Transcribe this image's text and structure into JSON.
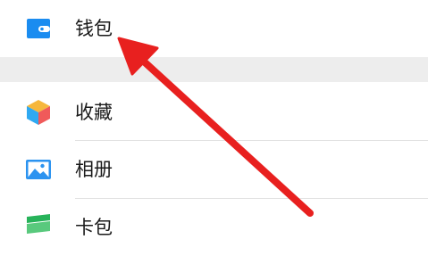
{
  "menu": {
    "items": [
      {
        "label": "钱包",
        "icon": "wallet-icon"
      },
      {
        "label": "收藏",
        "icon": "favorites-cube-icon"
      },
      {
        "label": "相册",
        "icon": "album-picture-icon"
      },
      {
        "label": "卡包",
        "icon": "card-bag-icon"
      }
    ]
  },
  "annotation": {
    "arrow": "red-arrow-pointing-to-wallet",
    "color": "#e8201f"
  },
  "colors": {
    "section_gap": "#ededed",
    "divider": "#e2e2e2",
    "wallet_blue": "#1a8cf0",
    "album_blue": "#2b93f0",
    "card_green": "#27b35a"
  }
}
